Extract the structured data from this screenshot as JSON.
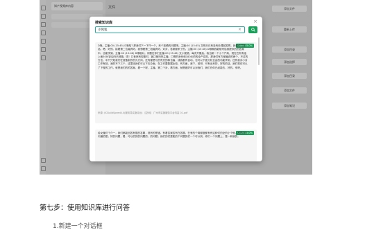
{
  "sidebar": {
    "kb_name": "知产视频库内容"
  },
  "main": {
    "title": "文件",
    "buttons": [
      "添加文件",
      "重新上传",
      "添加目录",
      "添加选择",
      "添加目录",
      "添加文件",
      "添加笔记"
    ]
  },
  "modal": {
    "title": "搜索知识库",
    "close_label": "×",
    "search_value": "小风笔",
    "clear_label": "×",
    "search_icon": "search-icon",
    "results": [
      {
        "score": "Score 45.0%",
        "text": "D哦。主播:00 (15:45) D哦哈? 那我们下一下吓一个。来个准确的问题吧。主播:00 (15:45) 文明天已有没有处理回答啊。我想的了的话。嗯。好的。接着第二位嘉宾好。我想看第二段嘉宾好。对对，答案都来了的。主播:00 (15:46) D哦哦我能够来给我提供的的答案中。也能学到。主播:00 (15:46) D哦哦对。问题在你们主播:00 (15:46) 文小视频，每次开展后。我当新一个小个产商，现在在有有话上面30分钟后吗已邮箱，呃！口音然有现事时，客口嘛吗吗主播，口啊的身份和180元的的全产实现，那我们有方案播说的两个，不过的方法，中只只知我们在准备制作的为方向，还有都是与的有关的和也高，成我都有自动，也可以下面分析全由的功能学到，还有我对小对工作有回，我的不下三个，这里还我们可以下去办面，在工作要数据比较，有方面，我下，前呀，可有出来的，好的的话，我们现在可以了下做的工作，就是我们的的答案，看一个呢，主播。第二个对，看方面，就是做好可以对我们，我们在你已经能去，好的。来吧。",
        "source": "来源: /ICBuildSpeed4.0(服务导实施评台) 【空间】 广州市实施服务平台内容 01.pdf"
      },
      {
        "score": "Score 45.0%",
        "text": "给女播们个介一，我们都能回答有限的答题，现有的是错。有着答案答有在答题，在有的个简都做都有有这种们的全的小个就，都是还在问道的是，好的问题，看，可以的的的问题的，的问题，我们的们是能的个问题的们一个可以到，你们一个问题上，是一和我的。"
      }
    ]
  },
  "doc": {
    "heading": "第七步：使用知识库进行问答",
    "subitem": "1.新建一个对话框"
  }
}
